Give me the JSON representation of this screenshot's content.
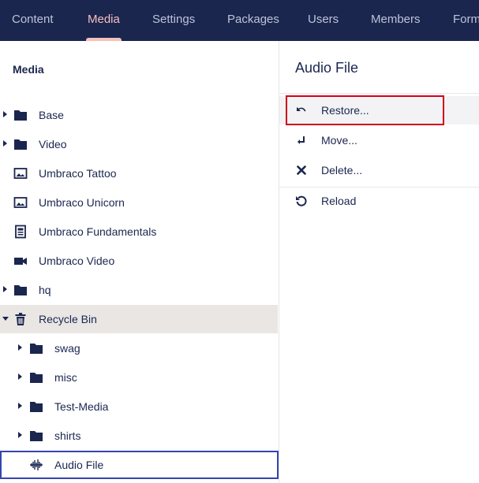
{
  "nav": {
    "tabs": [
      {
        "label": "Content"
      },
      {
        "label": "Media"
      },
      {
        "label": "Settings"
      },
      {
        "label": "Packages"
      },
      {
        "label": "Users"
      },
      {
        "label": "Members"
      },
      {
        "label": "Forms"
      }
    ],
    "active_tab": "Media"
  },
  "tree": {
    "title": "Media",
    "items": [
      {
        "label": "Base",
        "icon": "folder-icon",
        "expandable": true
      },
      {
        "label": "Video",
        "icon": "folder-icon",
        "expandable": true
      },
      {
        "label": "Umbraco Tattoo",
        "icon": "image-icon"
      },
      {
        "label": "Umbraco Unicorn",
        "icon": "image-icon"
      },
      {
        "label": "Umbraco Fundamentals",
        "icon": "document-icon"
      },
      {
        "label": "Umbraco Video",
        "icon": "video-camera-icon"
      },
      {
        "label": "hq",
        "icon": "folder-icon",
        "expandable": true
      },
      {
        "label": "Recycle Bin",
        "icon": "trash-icon",
        "expanded": true
      },
      {
        "label": "swag",
        "icon": "folder-icon",
        "expandable": true
      },
      {
        "label": "misc",
        "icon": "folder-icon",
        "expandable": true
      },
      {
        "label": "Test-Media",
        "icon": "folder-icon",
        "expandable": true
      },
      {
        "label": "shirts",
        "icon": "folder-icon",
        "expandable": true
      },
      {
        "label": "Audio File",
        "icon": "audio-waveform-icon",
        "selected": true
      }
    ]
  },
  "actions": {
    "title": "Audio File",
    "items": [
      {
        "label": "Restore...",
        "icon": "undo-icon"
      },
      {
        "label": "Move...",
        "icon": "move-icon"
      },
      {
        "label": "Delete...",
        "icon": "close-icon"
      },
      {
        "label": "Reload",
        "icon": "reload-icon"
      }
    ]
  },
  "colors": {
    "nav_bg": "#1b264f",
    "nav_text": "#bcc3d8",
    "nav_active": "#f5c1bc",
    "text": "#1b264f",
    "tree_highlight": "#e9e6e3",
    "selected_border": "#3544b1",
    "focus_border": "#d0021b"
  }
}
